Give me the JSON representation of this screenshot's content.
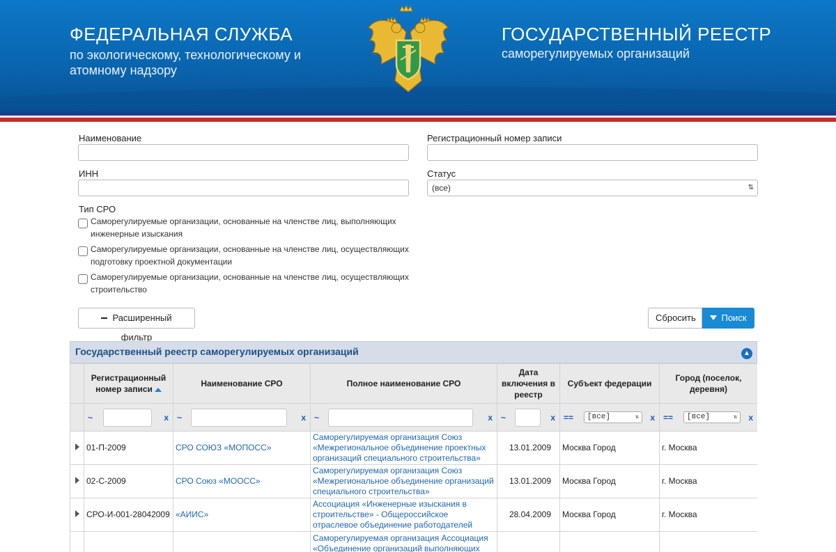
{
  "header": {
    "left_title": "ФЕДЕРАЛЬНАЯ СЛУЖБА",
    "left_subtitle": "по экологическому, технологическому и атомному надзору",
    "right_title": "ГОСУДАРСТВЕННЫЙ РЕЕСТР",
    "right_subtitle": "саморегулируемых организаций",
    "emblem_icon": "double-headed-eagle-emblem-icon"
  },
  "form": {
    "name_label": "Наименование",
    "name_value": "",
    "reg_label": "Регистрационный номер записи",
    "reg_value": "",
    "inn_label": "ИНН",
    "inn_value": "",
    "status_label": "Статус",
    "status_value": "(все)",
    "type_label": "Тип СРО",
    "types": [
      {
        "label": "Саморегулируемые организации, основанные на членстве лиц, выполняющих инженерные изыскания",
        "checked": false
      },
      {
        "label": "Саморегулируемые организации, основанные на членстве лиц, осуществляющих подготовку проектной документации",
        "checked": false
      },
      {
        "label": "Саморегулируемые организации, основанные на членстве лиц, осуществляющих строительство",
        "checked": false
      }
    ],
    "advanced_filter_label": "Расширенный фильтр",
    "reset_label": "Сбросить",
    "search_label": "Поиск"
  },
  "registry": {
    "title": "Государственный реестр саморегулируемых организаций",
    "columns": [
      "Регистрационный номер записи",
      "Наименование СРО",
      "Полное наименование СРО",
      "Дата включения в реестр",
      "Субъект федерации",
      "Город (поселок, деревня)"
    ],
    "filter": {
      "op_like": "~",
      "op_eq": "==",
      "clear": "x",
      "subject_select": "[все]",
      "city_select": "[все]"
    },
    "rows": [
      {
        "reg": "01-П-2009",
        "name": "СРО СОЮЗ «МОПОСС»",
        "full": "Саморегулируемая организация Союз «Межрегиональное объединение проектных организаций специального строительства»",
        "date": "13.01.2009",
        "subject": "Москва Город",
        "city": "г. Москва"
      },
      {
        "reg": "02-С-2009",
        "name": "СРО Союз «МООСС»",
        "full": "Саморегулируемая организация Союз «Межрегиональное объединение организаций специального строительства»",
        "date": "13.01.2009",
        "subject": "Москва Город",
        "city": "г. Москва"
      },
      {
        "reg": "СРО-И-001-28042009",
        "name": "«АИИС»",
        "full": "Ассоциация «Инженерные изыскания в строительстве» - Общероссийское отраслевое объединение работодателей",
        "date": "28.04.2009",
        "subject": "Москва Город",
        "city": "г. Москва"
      },
      {
        "reg": "",
        "name": "",
        "full": "Саморегулируемая организация Ассоциация «Объединение организаций выполняющих инженерные изыскания при архитектурно",
        "date": "",
        "subject": "",
        "city": ""
      }
    ]
  },
  "colors": {
    "header_blue": "#0a64ad",
    "flag_red": "#c92a2a",
    "primary_button": "#1a8ad4",
    "link": "#1f67ad",
    "panel_title": "#1c4f86"
  }
}
